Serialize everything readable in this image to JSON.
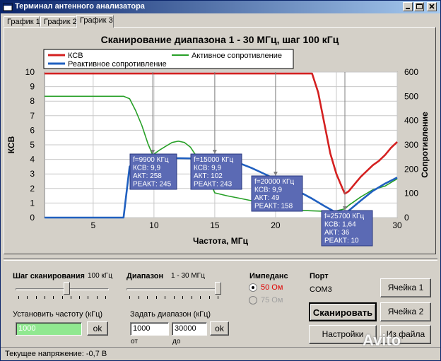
{
  "window": {
    "title": "Терминал антенного анализатора"
  },
  "tabs": [
    {
      "label": "График 1"
    },
    {
      "label": "График 2"
    },
    {
      "label": "График 3",
      "active": true
    }
  ],
  "chart": {
    "title": "Сканирование диапазона 1 - 30 МГц, шаг 100 кГц",
    "xlabel": "Частота, МГц",
    "ylabel_left": "КСВ",
    "ylabel_right": "Сопротивление",
    "legend": [
      "КСВ",
      "Активное сопротивление",
      "Реактивное сопротивление"
    ],
    "x_ticks": [
      "5",
      "10",
      "15",
      "20",
      "25",
      "30"
    ],
    "y_left_ticks": [
      "0",
      "1",
      "2",
      "3",
      "4",
      "5",
      "6",
      "7",
      "8",
      "9",
      "10"
    ],
    "y_right_ticks": [
      "0",
      "100",
      "200",
      "300",
      "400",
      "500",
      "600"
    ],
    "markers": [
      {
        "lines": [
          "f=9900 КГц",
          "КСВ: 9,9",
          "АКТ: 258",
          "РЕАКТ: 245"
        ]
      },
      {
        "lines": [
          "f=15000 КГц",
          "КСВ: 9,9",
          "АКТ: 102",
          "РЕАКТ: 243"
        ]
      },
      {
        "lines": [
          "f=20000 КГц",
          "КСВ: 9,9",
          "АКТ: 49",
          "РЕАКТ: 158"
        ]
      },
      {
        "lines": [
          "f=25700 КГц",
          "КСВ: 1,64",
          "АКТ: 36",
          "РЕАКТ: 10"
        ]
      }
    ]
  },
  "chart_data": {
    "type": "line",
    "title": "Сканирование диапазона 1 - 30 МГц, шаг 100 кГц",
    "xlabel": "Частота, МГц",
    "ylabel": "КСВ",
    "y2label": "Сопротивление",
    "xlim": [
      1,
      30
    ],
    "ylim": [
      0,
      10
    ],
    "y2lim": [
      0,
      600
    ],
    "grid": true,
    "legend_position": "top",
    "series": [
      {
        "name": "КСВ",
        "axis": "left",
        "color": "#d42020",
        "x": [
          1,
          23,
          23.5,
          24,
          24.5,
          25,
          25.5,
          25.7,
          26,
          26.5,
          27,
          27.5,
          28,
          28.5,
          29,
          29.5,
          30
        ],
        "y": [
          9.9,
          9.9,
          8.6,
          6.5,
          4.4,
          3.0,
          2.0,
          1.64,
          1.8,
          2.3,
          2.8,
          3.2,
          3.6,
          3.9,
          4.3,
          4.8,
          5.2
        ]
      },
      {
        "name": "Активное сопротивление",
        "axis": "right",
        "color": "#28a028",
        "x": [
          1,
          7.5,
          8,
          8.5,
          9,
          9.5,
          9.9,
          10.5,
          11,
          11.5,
          12,
          12.5,
          13,
          14,
          15,
          16,
          17,
          18,
          19,
          20,
          21,
          22,
          23,
          24,
          25,
          25.7,
          26,
          27,
          28,
          29,
          30
        ],
        "y": [
          500,
          500,
          490,
          440,
          380,
          305,
          258,
          280,
          295,
          310,
          315,
          310,
          290,
          215,
          102,
          90,
          80,
          70,
          60,
          49,
          40,
          30,
          28,
          26,
          28,
          36,
          50,
          85,
          115,
          130,
          160
        ]
      },
      {
        "name": "Реактивное сопротивление",
        "axis": "right",
        "color": "#2060c0",
        "x": [
          1,
          7.5,
          8,
          8.5,
          9,
          9.5,
          9.9,
          11,
          12,
          13,
          14,
          15,
          16,
          17,
          18,
          19,
          20,
          21,
          22,
          23,
          24,
          25,
          25.7,
          26,
          27,
          28,
          29,
          30
        ],
        "y": [
          0,
          0,
          210,
          235,
          242,
          245,
          245,
          245,
          245,
          244,
          244,
          243,
          238,
          225,
          205,
          182,
          158,
          133,
          105,
          78,
          48,
          20,
          10,
          28,
          70,
          110,
          140,
          165
        ]
      }
    ],
    "markers_x": [
      9.9,
      15,
      20,
      25.7
    ]
  },
  "controls": {
    "step_label": "Шаг сканирования",
    "step_value": "100 кГц",
    "step_level": 0.55,
    "range_label": "Диапазон",
    "range_value": "1 - 30 МГц",
    "range_level": 1.0,
    "set_freq_label": "Установить частоту (кГц)",
    "set_freq_value": "1000",
    "ok": "ok",
    "set_range_label": "Задать диапазон (кГц)",
    "range_from": "1000",
    "range_to": "30000",
    "from_label": "от",
    "to_label": "до",
    "impedance_label": "Импеданс",
    "imp_50": "50 Ом",
    "imp_75": "75 Ом",
    "port_label": "Порт",
    "port_value": "COM3",
    "scan_button": "Сканировать",
    "settings_button": "Настройки",
    "cell1_button": "Ячейка 1",
    "cell2_button": "Ячейка 2",
    "fromfile_button": "Из файла"
  },
  "status": {
    "text": "Текущее напряжение: -0,7 В"
  },
  "watermark": "Avito"
}
